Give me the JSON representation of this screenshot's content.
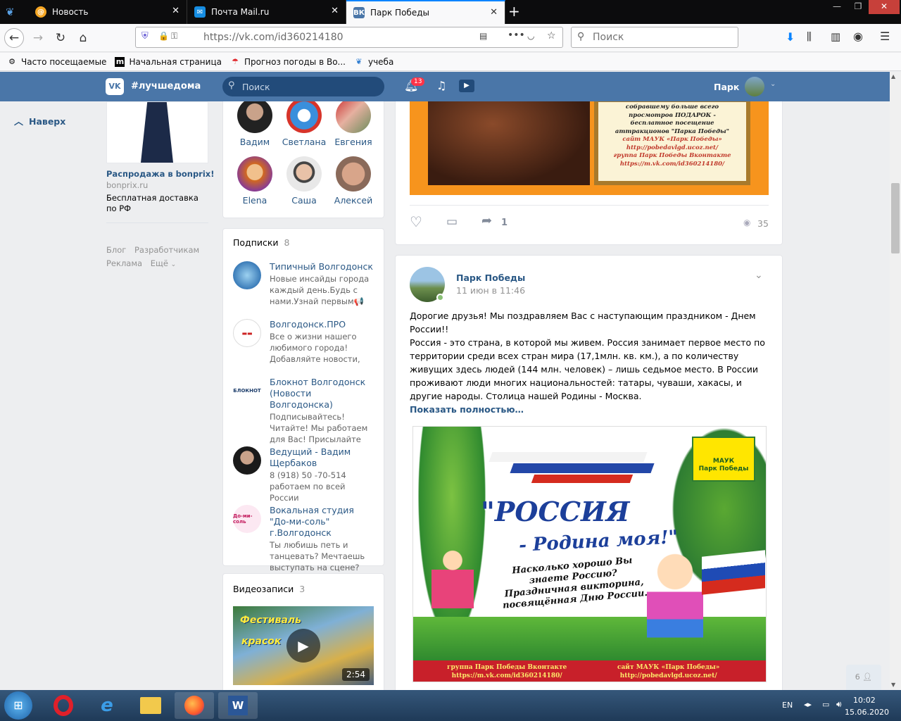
{
  "browser": {
    "tabs": [
      {
        "title": "Новость",
        "active": false
      },
      {
        "title": "Почта Mail.ru",
        "active": false
      },
      {
        "title": "Парк Победы",
        "active": true
      }
    ],
    "url": "https://vk.com/id360214180",
    "search_placeholder": "Поиск",
    "bookmarks": [
      "Часто посещаемые",
      "Начальная страница",
      "Прогноз погоды в Во...",
      "учеба"
    ]
  },
  "vk": {
    "hashtag": "#лучшедома",
    "search_placeholder": "Поиск",
    "notif_count": "13",
    "user_name": "Парк",
    "back_to_top": "Наверх",
    "ad": {
      "title": "Распродажа в bonprix!",
      "domain": "bonprix.ru",
      "text": "Бесплатная доставка по РФ"
    },
    "footer": {
      "blog": "Блог",
      "devs": "Разработчикам",
      "ads": "Реклама",
      "more": "Ещё"
    },
    "friends": [
      "Вадим",
      "Светлана",
      "Евгения",
      "Elena",
      "Саша",
      "Алексей"
    ],
    "subscriptions": {
      "title": "Подписки",
      "count": "8",
      "items": [
        {
          "name": "Типичный Волгодонск",
          "desc": "Новые инсайды города каждый день.Будь с нами.Узнай первым📢"
        },
        {
          "name": "Волгодонск.ПРО",
          "desc": "Все о жизни нашего любимого города! Добавляйте новости,"
        },
        {
          "name": "Блокнот Волгодонск (Новости Волгодонска)",
          "desc": "Подписывайтесь! Читайте! Мы работаем для Вас! Присылайте"
        },
        {
          "name": "Ведущий - Вадим Щербаков",
          "desc": "8 (918) 50 -70-514 работаем по всей России"
        },
        {
          "name": "Вокальная студия \"До-ми-соль\" г.Волгодонск",
          "desc": "Ты любишь петь и танцевать? Мечтаешь выступать на сцене?"
        }
      ]
    },
    "videos": {
      "title": "Видеозаписи",
      "count": "3",
      "duration": "2:54",
      "thumb_text1": "Фестиваль",
      "thumb_text2": "красок"
    },
    "post1": {
      "image_lines": [
        "собравшему больше всего",
        "просмотров ПОДАРОК -",
        "бесплатное посещение",
        "аттракционов \"Парка Победы\"",
        "сайт МАУК «Парк Победы»",
        "http://pobedavlgd.ucoz.net/",
        "группа Парк Победы Вконтакте",
        "https://m.vk.com/id360214180/"
      ],
      "shares": "1",
      "views": "35"
    },
    "post2": {
      "author": "Парк Победы",
      "date": "11 июн в 11:46",
      "text_p1": "Дорогие друзья! Мы поздравляем Вас с наступающим праздником - Днем России!!",
      "text_p2": "Россия - это страна, в которой мы живем. Россия занимает первое место по территории среди всех стран мира (17,1млн. кв. км.), а по количеству живущих здесь людей (144 млн. человек) – лишь седьмое место. В России проживают люди многих национальностей: татары, чуваши, хакасы, и другие народы. Столица нашей Родины - Москва.",
      "show_more": "Показать полностью…",
      "img_title1": "\"РОССИЯ",
      "img_title2": "- Родина моя!\"",
      "img_sub": "Насколько хорошо Вы знаете Россию? Праздничная викторина, посвящённая Дню России.",
      "logo1": "МАУК",
      "logo2": "Парк Победы",
      "footer_left1": "группа Парк Победы Вконтакте",
      "footer_left2": "https://m.vk.com/id360214180/",
      "footer_right1": "сайт МАУК «Парк Победы»",
      "footer_right2": "http://pobedavlgd.ucoz.net/"
    },
    "online_count": "6"
  },
  "taskbar": {
    "lang": "EN",
    "time": "10:02",
    "date": "15.06.2020"
  },
  "colors": {
    "vk_blue": "#4a76a8",
    "link": "#2a5885",
    "bg": "#edeef0"
  }
}
